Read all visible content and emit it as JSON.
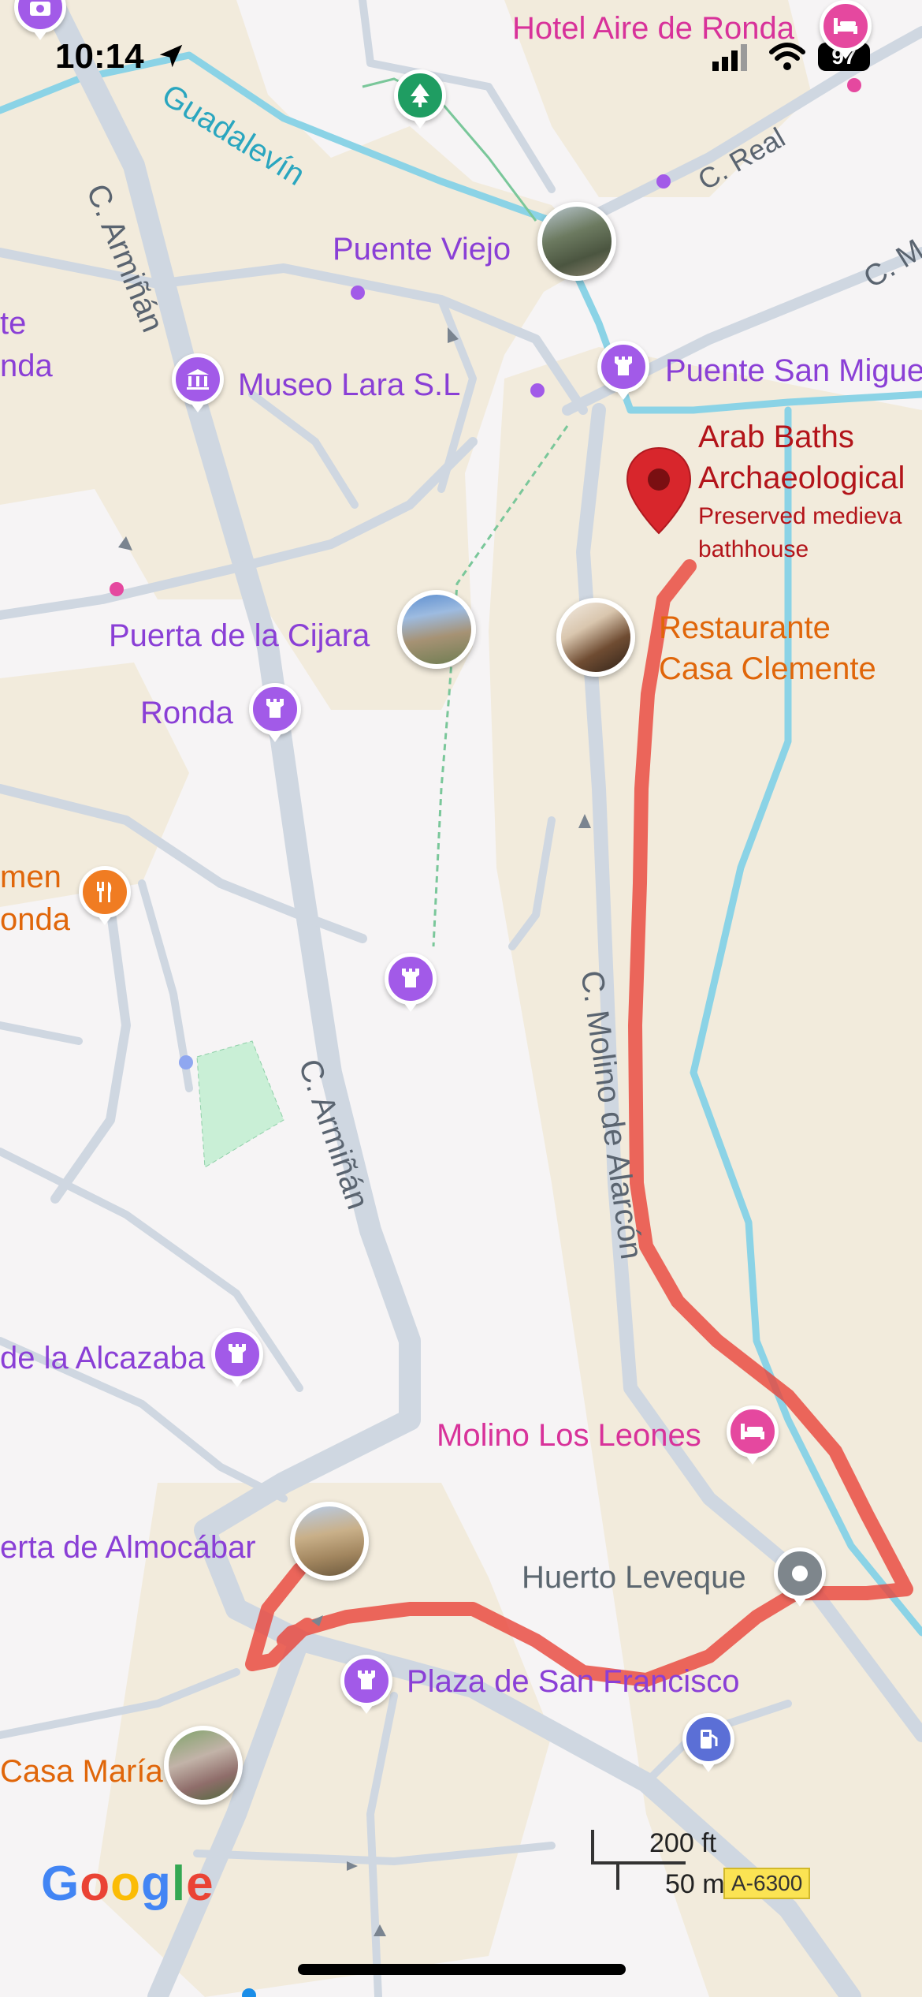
{
  "status_bar": {
    "time": "10:14",
    "battery": "97"
  },
  "route": {
    "color": "#e8443a"
  },
  "colors": {
    "road": "#cfd7e1",
    "river": "#7fd0e3",
    "land": "#f2ebdc",
    "poi_purple": "#8a3fd6",
    "poi_pink": "#d8329a",
    "poi_orange": "#e0660a",
    "red_pin": "#d8262c"
  },
  "streets": {
    "c_arminan_top": "C. Armiñán",
    "c_arminan_mid": "C. Armiñán",
    "c_molino": "C. Molino de Alarcón",
    "c_real": "C. Real",
    "c_m": "C. M",
    "river": "Guadalevín"
  },
  "pois": {
    "hotel_aire": "Hotel Aire de Ronda",
    "puente_viejo": "Puente Viejo",
    "museo_lara": "Museo Lara S.L",
    "puente_san_miguel": "Puente San Migue",
    "arab_baths_1": "Arab Baths",
    "arab_baths_2": "Archaeological",
    "arab_baths_desc_1": "Preserved medieva",
    "arab_baths_desc_2": "bathhouse",
    "restaurante_1": "Restaurante",
    "restaurante_2": "Casa Clemente",
    "puerta_cijara": "Puerta de la Cijara",
    "ronda": "Ronda",
    "left_ronda_1": "te",
    "left_ronda_2": "nda",
    "carmen_1": "men",
    "carmen_2": "onda",
    "alcazaba": "de la Alcazaba",
    "molino_leones": "Molino Los Leones",
    "almocabar": "erta de Almocábar",
    "huerto": "Huerto Leveque",
    "plaza_sf": "Plaza de San Francisco",
    "casa_maria": "Casa María"
  },
  "icons": {
    "tower": "castle-tower-icon",
    "hotel": "bed-icon",
    "museum": "museum-icon",
    "restaurant": "fork-knife-icon",
    "park": "tree-icon",
    "fuel": "fuel-pump-icon"
  },
  "scale": {
    "feet": "200 ft",
    "meters": "50 m"
  },
  "road_badge": "A-6300",
  "logo": "Google"
}
